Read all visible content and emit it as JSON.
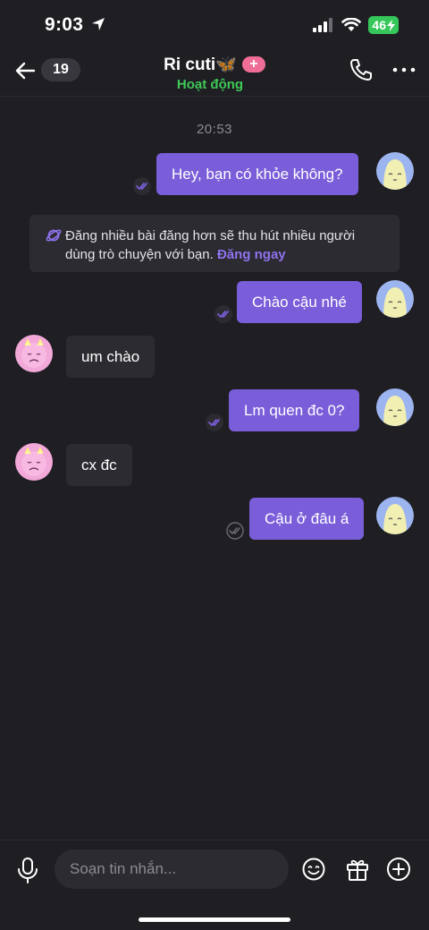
{
  "status": {
    "time": "9:03",
    "battery": "46"
  },
  "header": {
    "unread_count": "19",
    "title": "Ri cuti🦋",
    "plus": "+",
    "subtitle": "Hoạt động"
  },
  "chat": {
    "timestamp": "20:53",
    "notice": {
      "text": "Đăng nhiều bài đăng hơn sẽ thu hút nhiều người dùng trò chuyện với bạn.",
      "link": "Đăng ngay"
    },
    "messages": [
      {
        "from": "me",
        "text": "Hey, bạn có khỏe không?",
        "status": "read"
      },
      {
        "from": "me",
        "text": "Chào cậu nhé",
        "status": "read"
      },
      {
        "from": "them",
        "text": "um chào"
      },
      {
        "from": "me",
        "text": "Lm quen đc 0?",
        "status": "read"
      },
      {
        "from": "them",
        "text": "cx đc"
      },
      {
        "from": "me",
        "text": "Cậu ở đâu á",
        "status": "sent"
      }
    ]
  },
  "input": {
    "placeholder": "Soạn tin nhắn..."
  },
  "colors": {
    "background": "#1f1e23",
    "outgoing_bubble": "#7a5ed9",
    "incoming_bubble": "#2c2b31",
    "online": "#3ec957",
    "accent_link": "#8f73f0",
    "battery": "#36c75a",
    "plus_badge": "#ef6d96"
  }
}
